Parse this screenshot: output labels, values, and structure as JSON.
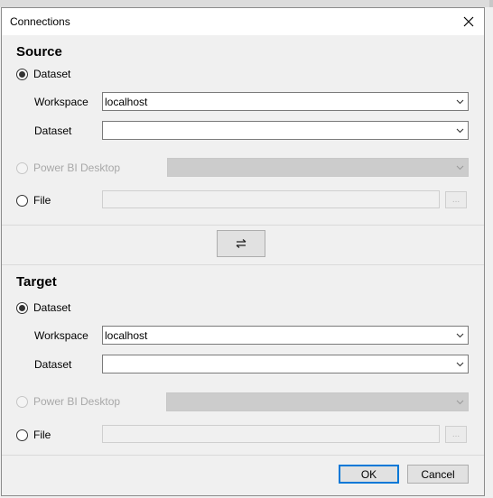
{
  "window": {
    "title": "Connections"
  },
  "source": {
    "heading": "Source",
    "dataset_option": "Dataset",
    "workspace_label": "Workspace",
    "workspace_value": "localhost",
    "dataset_label": "Dataset",
    "dataset_value": "",
    "pbi_option": "Power BI Desktop",
    "file_option": "File",
    "browse_label": "..."
  },
  "target": {
    "heading": "Target",
    "dataset_option": "Dataset",
    "workspace_label": "Workspace",
    "workspace_value": "localhost",
    "dataset_label": "Dataset",
    "dataset_value": "",
    "pbi_option": "Power BI Desktop",
    "file_option": "File",
    "browse_label": "..."
  },
  "footer": {
    "ok_label": "OK",
    "cancel_label": "Cancel"
  },
  "icons": {
    "close": "close-icon",
    "swap": "swap-icon",
    "dropdown": "chevron-down-icon"
  }
}
